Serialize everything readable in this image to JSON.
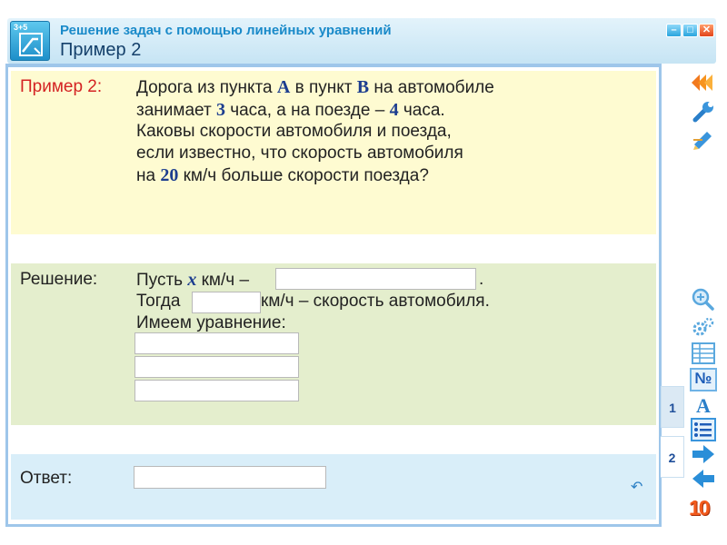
{
  "window": {
    "app_icon_label": "3+5",
    "title": "Решение задач с помощью линейных уравнений",
    "subtitle": "Пример 2",
    "minimize_glyph": "–",
    "maximize_glyph": "□",
    "close_glyph": "✕"
  },
  "problem": {
    "label": "Пример 2:",
    "line1": {
      "a": "Дорога из пункта ",
      "b": "А",
      "c": " в пункт ",
      "d": "В",
      "e": " на автомобиле"
    },
    "line2": {
      "a": "занимает ",
      "b": "3",
      "c": " часа, а на поезде  – ",
      "d": "4",
      "e": " часа."
    },
    "line3": "Каковы скорости автомобиля и поезда,",
    "line4": "если известно, что скорость автомобиля",
    "line5": {
      "a": "на ",
      "b": "20",
      "c": " км/ч больше скорости поезда?"
    }
  },
  "solution": {
    "label": "Решение:",
    "line1": {
      "a": "Пусть ",
      "x": "x",
      "b": " км/ч – ",
      "end": "."
    },
    "line2": {
      "a": "Тогда",
      "b": " км/ч – скорость автомобиля."
    },
    "line3": "Имеем уравнение:"
  },
  "answer": {
    "label": "Ответ:"
  },
  "tabs": [
    "1",
    "2"
  ],
  "toolbar": {
    "icons": [
      "rewind-icon",
      "wrench-icon",
      "pencil-eraser-icon",
      "magnifier-icon",
      "gears-icon",
      "table-icon",
      "numero-icon",
      "letter-a-icon",
      "list-icon",
      "arrow-right-icon",
      "arrow-left-icon"
    ],
    "numero_glyph": "№",
    "letter_glyph": "A",
    "page_counter": "10"
  },
  "undo_glyph": "↶",
  "colors": {
    "problem_bg": "#fefbd1",
    "solution_bg": "#e4eecd",
    "answer_bg": "#d9eef9",
    "label_red": "#d42323",
    "accent_blue": "#1a8ac9",
    "highlight": "#1c3d8f"
  }
}
